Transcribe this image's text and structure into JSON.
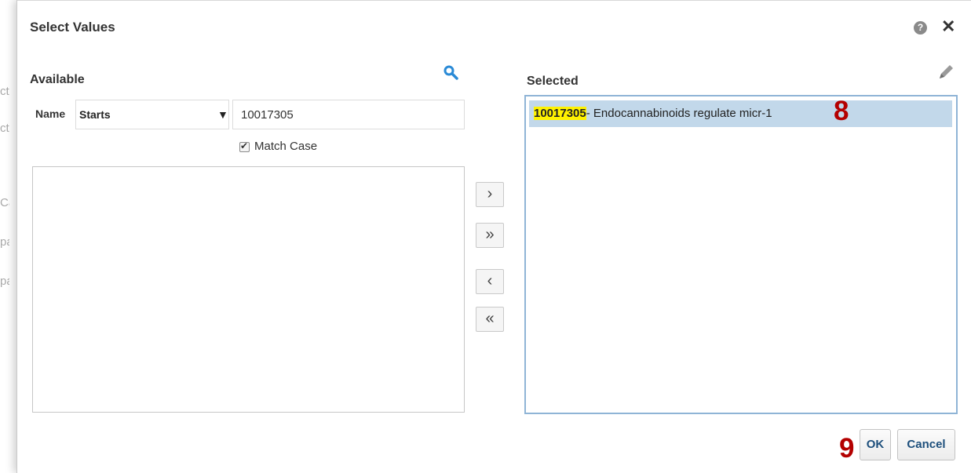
{
  "background_fragments": [
    "ct",
    "ct l",
    "Ca",
    "pa",
    "pa"
  ],
  "dialog": {
    "title": "Select Values",
    "help_glyph": "?",
    "close_glyph": "✕"
  },
  "available": {
    "label": "Available",
    "name_label": "Name",
    "operator_value": "Starts",
    "search_value": "10017305",
    "match_case_label": "Match Case",
    "match_case_checked": true,
    "items": []
  },
  "selected": {
    "label": "Selected",
    "items": [
      {
        "highlight": "10017305",
        "rest": "- Endocannabinoids regulate micr-1"
      }
    ]
  },
  "move_buttons": {
    "move": "›",
    "move_all": "»",
    "remove": "‹",
    "remove_all": "«"
  },
  "annotations": {
    "step_8": "8",
    "step_9": "9"
  },
  "footer": {
    "ok_label": "OK",
    "cancel_label": "Cancel"
  },
  "colors": {
    "accent": "#1d4f7c",
    "selection": "#c2d8ea",
    "highlight": "#fff200",
    "annotation": "#b40000",
    "icon_blue": "#2a8ad6"
  },
  "icons": {
    "search": "search-icon",
    "edit": "pencil-icon",
    "help": "help-icon",
    "close": "close-icon"
  }
}
